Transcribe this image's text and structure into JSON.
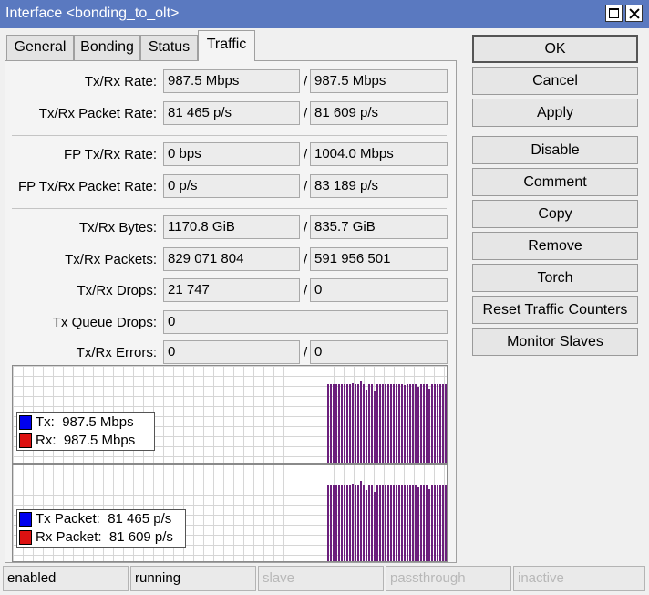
{
  "window": {
    "title": "Interface <bonding_to_olt>"
  },
  "tabs": [
    "General",
    "Bonding",
    "Status",
    "Traffic"
  ],
  "rows": {
    "txrx_rate": {
      "label": "Tx/Rx Rate:",
      "tx": "987.5 Mbps",
      "rx": "987.5 Mbps"
    },
    "txrx_packet_rate": {
      "label": "Tx/Rx Packet Rate:",
      "tx": "81 465 p/s",
      "rx": "81 609 p/s"
    },
    "fp_txrx_rate": {
      "label": "FP Tx/Rx Rate:",
      "tx": "0 bps",
      "rx": "1004.0 Mbps"
    },
    "fp_txrx_packet_rate": {
      "label": "FP Tx/Rx Packet Rate:",
      "tx": "0 p/s",
      "rx": "83 189 p/s"
    },
    "txrx_bytes": {
      "label": "Tx/Rx Bytes:",
      "tx": "1170.8 GiB",
      "rx": "835.7 GiB"
    },
    "txrx_packets": {
      "label": "Tx/Rx Packets:",
      "tx": "829 071 804",
      "rx": "591 956 501"
    },
    "txrx_drops": {
      "label": "Tx/Rx Drops:",
      "tx": "21 747",
      "rx": "0"
    },
    "tx_queue_drops": {
      "label": "Tx Queue Drops:",
      "value": "0"
    },
    "txrx_errors": {
      "label": "Tx/Rx Errors:",
      "tx": "0",
      "rx": "0"
    },
    "slash": "/"
  },
  "graphs": {
    "rate": {
      "tx_label": "Tx:",
      "tx_value": "987.5 Mbps",
      "rx_label": "Rx:",
      "rx_value": "987.5 Mbps"
    },
    "packets": {
      "tx_label": "Tx Packet:",
      "tx_value": "81 465 p/s",
      "rx_label": "Rx Packet:",
      "rx_value": "81 609 p/s"
    },
    "colors": {
      "tx": "#0000ee",
      "rx": "#dd1111",
      "bar": "#6b1f7c"
    }
  },
  "buttons": [
    "OK",
    "Cancel",
    "Apply",
    "Disable",
    "Comment",
    "Copy",
    "Remove",
    "Torch",
    "Reset Traffic Counters",
    "Monitor Slaves"
  ],
  "statusbar": [
    "enabled",
    "running",
    "slave",
    "passthrough",
    "inactive"
  ]
}
